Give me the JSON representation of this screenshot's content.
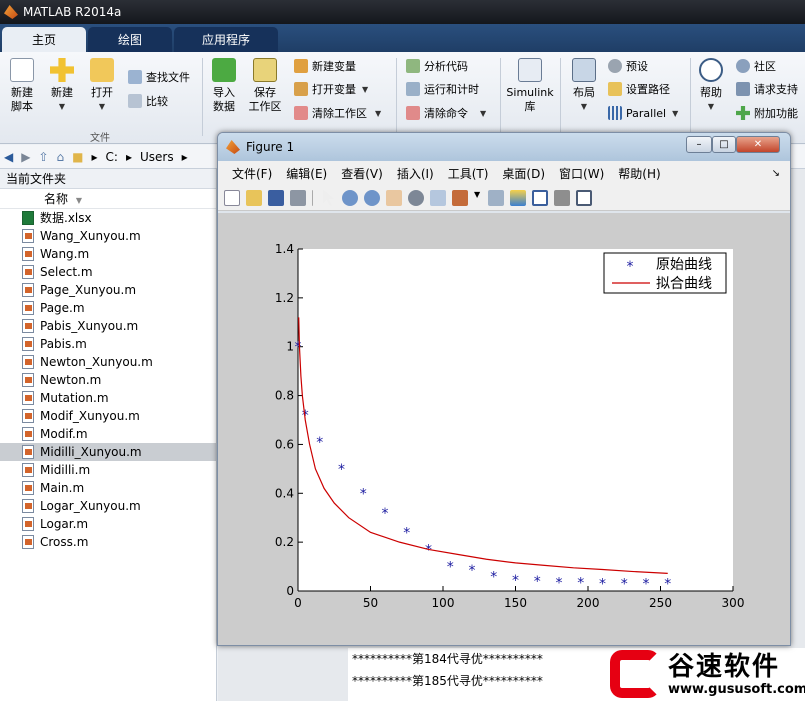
{
  "window": {
    "title": "MATLAB R2014a"
  },
  "tabs": [
    "主页",
    "绘图",
    "应用程序"
  ],
  "ribbon": {
    "file_group": {
      "label": "文件",
      "new_script": "新建\n脚本",
      "new": "新建",
      "open": "打开",
      "find_files": "查找文件",
      "compare": "比较"
    },
    "variable_group": {
      "import_data": "导入\n数据",
      "save_workspace": "保存\n工作区",
      "new_variable": "新建变量",
      "open_variable": "打开变量",
      "clear_workspace": "清除工作区"
    },
    "code_group": {
      "analyze_code": "分析代码",
      "run_and_time": "运行和计时",
      "clear_commands": "清除命令"
    },
    "simulink": "Simulink\n库",
    "environment": {
      "layout": "布局",
      "preferences": "预设",
      "set_path": "设置路径",
      "parallel": "Parallel"
    },
    "resources": {
      "help": "帮助",
      "community": "社区",
      "request_support": "请求支持",
      "add_ons": "附加功能"
    }
  },
  "address": {
    "segments": [
      "C:",
      "Users"
    ]
  },
  "current_folder": {
    "title": "当前文件夹",
    "column_name": "名称",
    "files": [
      {
        "name": "数据.xlsx",
        "type": "x"
      },
      {
        "name": "Wang_Xunyou.m",
        "type": "m"
      },
      {
        "name": "Wang.m",
        "type": "m"
      },
      {
        "name": "Select.m",
        "type": "m"
      },
      {
        "name": "Page_Xunyou.m",
        "type": "m"
      },
      {
        "name": "Page.m",
        "type": "m"
      },
      {
        "name": "Pabis_Xunyou.m",
        "type": "m"
      },
      {
        "name": "Pabis.m",
        "type": "m"
      },
      {
        "name": "Newton_Xunyou.m",
        "type": "m"
      },
      {
        "name": "Newton.m",
        "type": "m"
      },
      {
        "name": "Mutation.m",
        "type": "m"
      },
      {
        "name": "Modif_Xunyou.m",
        "type": "m"
      },
      {
        "name": "Modif.m",
        "type": "m"
      },
      {
        "name": "Midilli_Xunyou.m",
        "type": "m",
        "selected": true
      },
      {
        "name": "Midilli.m",
        "type": "m"
      },
      {
        "name": "Main.m",
        "type": "m"
      },
      {
        "name": "Logar_Xunyou.m",
        "type": "m"
      },
      {
        "name": "Logar.m",
        "type": "m"
      },
      {
        "name": "Cross.m",
        "type": "m"
      }
    ]
  },
  "command_window": {
    "lines": [
      "**********第184代寻优**********",
      "**********第185代寻优**********"
    ]
  },
  "figure": {
    "title": "Figure 1",
    "menu": [
      "文件(F)",
      "编辑(E)",
      "查看(V)",
      "插入(I)",
      "工具(T)",
      "桌面(D)",
      "窗口(W)",
      "帮助(H)"
    ]
  },
  "chart_data": {
    "type": "scatter",
    "title": "",
    "xlabel": "",
    "ylabel": "",
    "xlim": [
      0,
      300
    ],
    "ylim": [
      0,
      1.4
    ],
    "xticks": [
      0,
      50,
      100,
      150,
      200,
      250,
      300
    ],
    "yticks": [
      0,
      0.2,
      0.4,
      0.6,
      0.8,
      1,
      1.2,
      1.4
    ],
    "legend_position": "top-right",
    "series": [
      {
        "name": "原始曲线",
        "kind": "points",
        "color": "#1a1aa0",
        "x": [
          0,
          5,
          15,
          30,
          45,
          60,
          75,
          90,
          105,
          120,
          135,
          150,
          165,
          180,
          195,
          210,
          225,
          240,
          255
        ],
        "y": [
          1.0,
          0.72,
          0.61,
          0.5,
          0.4,
          0.32,
          0.24,
          0.17,
          0.1,
          0.085,
          0.06,
          0.045,
          0.04,
          0.035,
          0.035,
          0.03,
          0.03,
          0.03,
          0.03
        ]
      },
      {
        "name": "拟合曲线",
        "kind": "line",
        "color": "#cc0000",
        "x": [
          0.5,
          1,
          2,
          3,
          5,
          8,
          12,
          18,
          25,
          35,
          50,
          70,
          90,
          110,
          130,
          150,
          170,
          190,
          210,
          230,
          255
        ],
        "y": [
          1.12,
          1.0,
          0.88,
          0.8,
          0.7,
          0.6,
          0.5,
          0.42,
          0.36,
          0.3,
          0.24,
          0.2,
          0.17,
          0.15,
          0.13,
          0.115,
          0.105,
          0.095,
          0.088,
          0.08,
          0.072
        ]
      }
    ]
  },
  "watermark": {
    "name": "谷速软件",
    "url": "www.gususoft.com"
  }
}
